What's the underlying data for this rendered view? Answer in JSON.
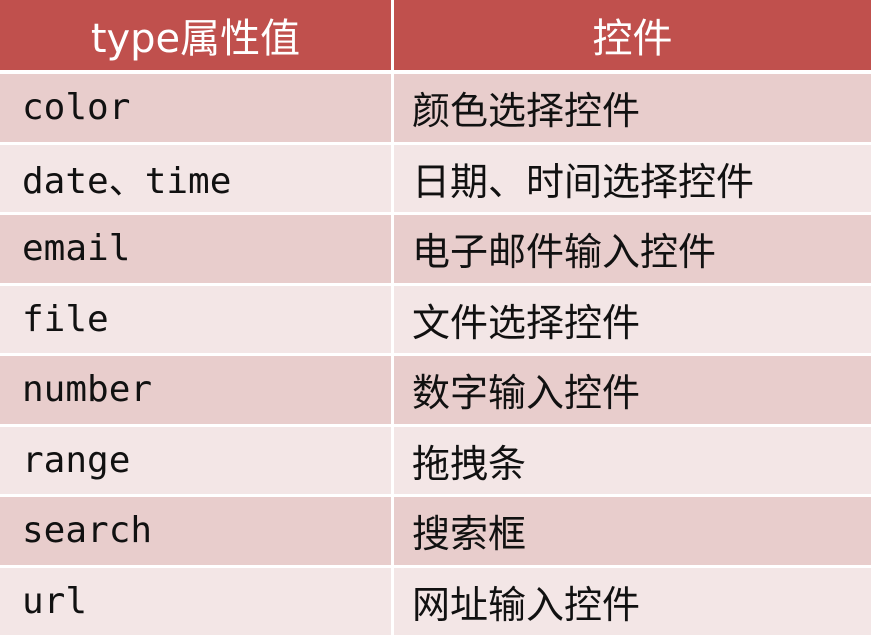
{
  "header": {
    "col_type": "type属性值",
    "col_control": "控件"
  },
  "rows": [
    {
      "type": "color",
      "control": "颜色选择控件"
    },
    {
      "type": "date、time",
      "control": "日期、时间选择控件"
    },
    {
      "type": "email",
      "control": "电子邮件输入控件"
    },
    {
      "type": "file",
      "control": "文件选择控件"
    },
    {
      "type": "number",
      "control": "数字输入控件"
    },
    {
      "type": "range",
      "control": "拖拽条"
    },
    {
      "type": "search",
      "control": "搜索框"
    },
    {
      "type": "url",
      "control": "网址输入控件"
    }
  ],
  "colors": {
    "header_bg": "#c0504d",
    "row_odd_bg": "#e8cdcc",
    "row_even_bg": "#f3e6e6"
  }
}
